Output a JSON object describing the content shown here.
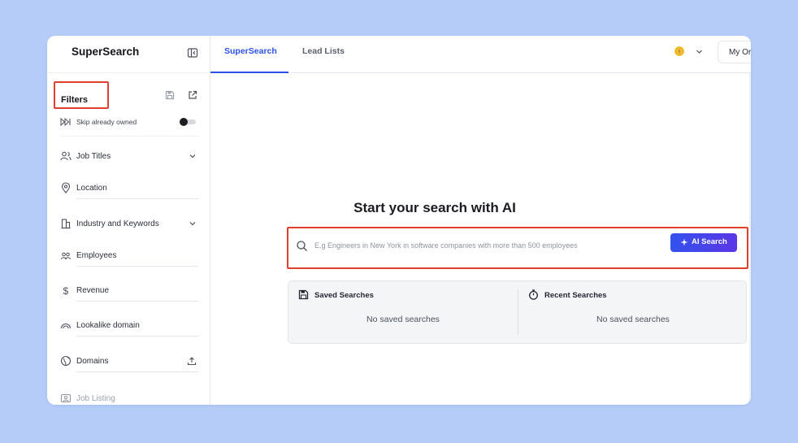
{
  "colors": {
    "background": "#b6ccf8",
    "accent": "#2b50e6",
    "highlight_border": "#e0402b",
    "button_gradient_start": "#3352ee",
    "button_gradient_end": "#5a36e6"
  },
  "sidebar": {
    "brand": "SuperSearch",
    "collapse_icon": "sidebar-collapse-icon",
    "filters_title": "Filters",
    "save_icon": "save-icon",
    "open_icon": "external-link-icon",
    "skip_owned": {
      "label": "Skip already owned",
      "icon": "skip-forward-icon",
      "enabled": false
    },
    "filters": [
      {
        "label": "Job Titles",
        "icon": "users-icon",
        "expandable": true
      },
      {
        "label": "Location",
        "icon": "map-pin-icon"
      },
      {
        "label": "Industry and Keywords",
        "icon": "building-icon",
        "expandable": true
      },
      {
        "label": "Employees",
        "icon": "people-icon"
      },
      {
        "label": "Revenue",
        "icon": "dollar-icon"
      },
      {
        "label": "Lookalike domain",
        "icon": "rainbow-icon"
      },
      {
        "label": "Domains",
        "icon": "globe-icon",
        "action_icon": "upload-icon"
      },
      {
        "label": "Job Listing",
        "icon": "id-card-icon"
      }
    ]
  },
  "topbar": {
    "tabs": [
      {
        "label": "SuperSearch",
        "active": true
      },
      {
        "label": "Lead Lists",
        "active": false
      }
    ],
    "credits_icon": "coin-icon",
    "org_button": "My Or"
  },
  "main": {
    "title": "Start your search with AI",
    "search": {
      "placeholder": "E.g Engineers in New York in software companies with more than 500 employees",
      "value": "",
      "button_label": "AI Search"
    },
    "saved": {
      "title": "Saved Searches",
      "empty": "No saved searches",
      "icon": "save-icon"
    },
    "recent": {
      "title": "Recent Searches",
      "empty": "No saved searches",
      "icon": "stopwatch-icon"
    }
  }
}
